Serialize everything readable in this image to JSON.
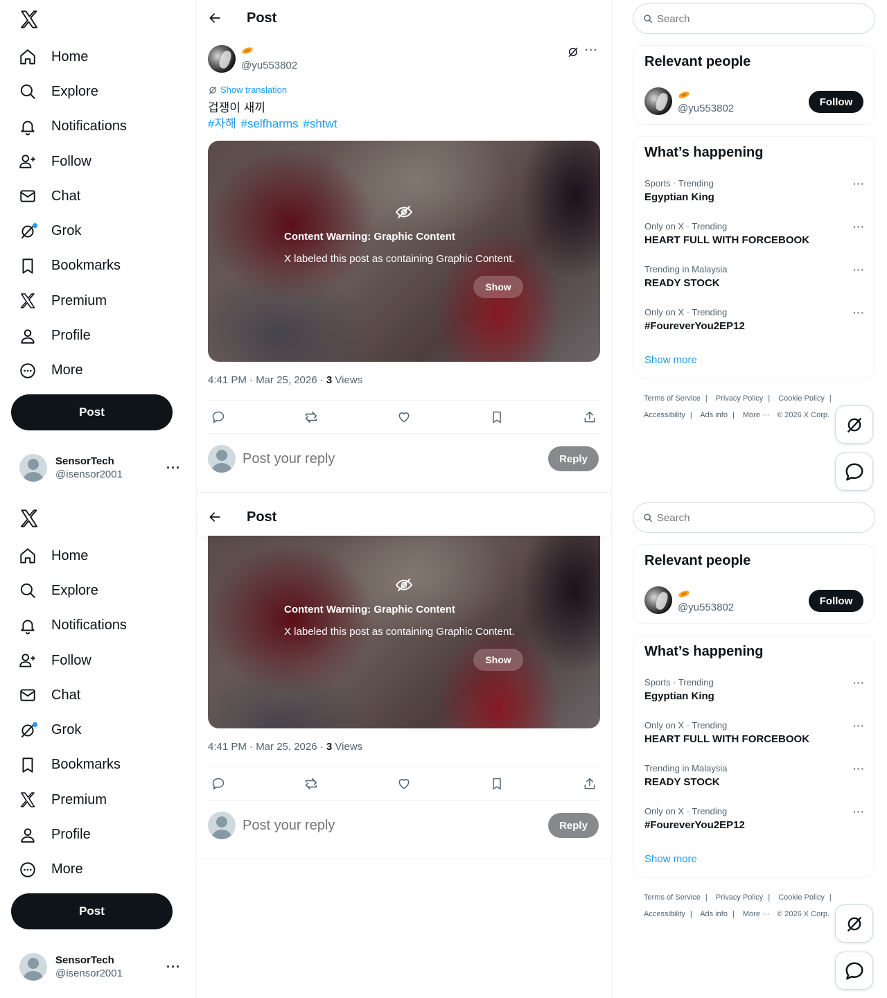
{
  "nav": {
    "items": [
      {
        "label": "Home",
        "icon": "home-icon"
      },
      {
        "label": "Explore",
        "icon": "search-icon"
      },
      {
        "label": "Notifications",
        "icon": "bell-icon"
      },
      {
        "label": "Follow",
        "icon": "person-add-icon"
      },
      {
        "label": "Chat",
        "icon": "mail-icon"
      },
      {
        "label": "Grok",
        "icon": "grok-icon"
      },
      {
        "label": "Bookmarks",
        "icon": "bookmark-icon"
      },
      {
        "label": "Premium",
        "icon": "x-logo-icon"
      },
      {
        "label": "Profile",
        "icon": "person-icon"
      },
      {
        "label": "More",
        "icon": "more-circle-icon"
      }
    ],
    "post_label": "Post"
  },
  "account": {
    "name": "SensorTech",
    "handle": "@isensor2001"
  },
  "header": {
    "title": "Post"
  },
  "post": {
    "handle": "@yu553802",
    "translate_label": "Show translation",
    "text": "겁쟁이 새끼",
    "hashtags": [
      "#자해",
      "#selfharms",
      "#shtwt"
    ],
    "warning_title": "Content Warning: Graphic Content",
    "warning_desc": "X labeled this post as containing Graphic Content.",
    "show_label": "Show",
    "time": "4:41 PM · Mar 25, 2026 · ",
    "views_count": "3",
    "views_label": " Views"
  },
  "reply": {
    "placeholder": "Post your reply",
    "button": "Reply"
  },
  "search": {
    "placeholder": "Search"
  },
  "people": {
    "title": "Relevant people",
    "handle": "@yu553802",
    "follow": "Follow"
  },
  "trends": {
    "title": "What’s happening",
    "items": [
      {
        "meta": "Sports · Trending",
        "name": "Egyptian King"
      },
      {
        "meta": "Only on X · Trending",
        "name": "HEART FULL WITH FORCEBOOK"
      },
      {
        "meta": "Trending in Malaysia",
        "name": "READY STOCK"
      },
      {
        "meta": "Only on X · Trending",
        "name": "#FoureverYou2EP12"
      }
    ],
    "show_more": "Show more"
  },
  "footer": {
    "links": [
      "Terms of Service",
      "Privacy Policy",
      "Cookie Policy",
      "Accessibility",
      "Ads info",
      "More ···"
    ],
    "copyright": "© 2026 X Corp."
  },
  "colors": {
    "accent": "#1d9bf0",
    "text": "#0f1419",
    "muted": "#536471",
    "dot": "#1d9bf0"
  }
}
